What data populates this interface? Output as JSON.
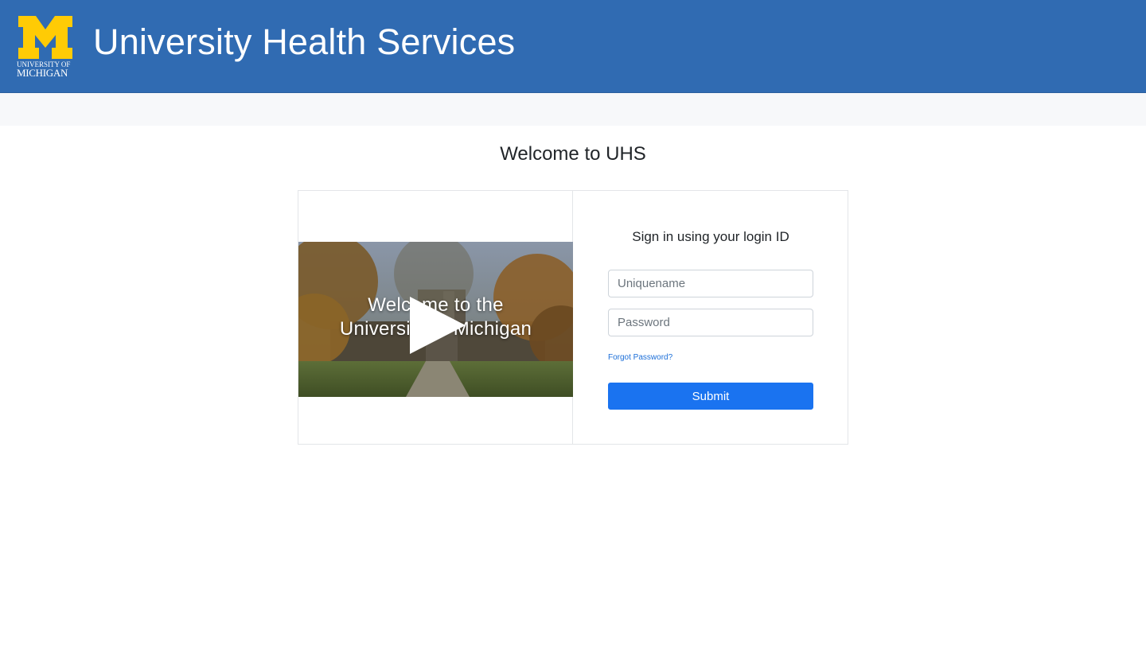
{
  "header": {
    "logo": {
      "icon": "block-m-logo",
      "line1": "UNIVERSITY OF",
      "line2": "MICHIGAN"
    },
    "title": "University Health Services"
  },
  "main": {
    "heading": "Welcome to UHS"
  },
  "video": {
    "title_line1": "Welcome to the",
    "title_line2": "University of Michigan",
    "icon": "play-icon"
  },
  "signin": {
    "title": "Sign in using your login ID",
    "username_placeholder": "Uniquename",
    "password_placeholder": "Password",
    "forgot_label": "Forgot Password?",
    "submit_label": "Submit"
  },
  "colors": {
    "header_bg": "#306bb2",
    "maize": "#ffcb05",
    "subnav_bg": "#f7f8fa",
    "primary_button": "#1a73f0",
    "link": "#1b6ed8"
  }
}
